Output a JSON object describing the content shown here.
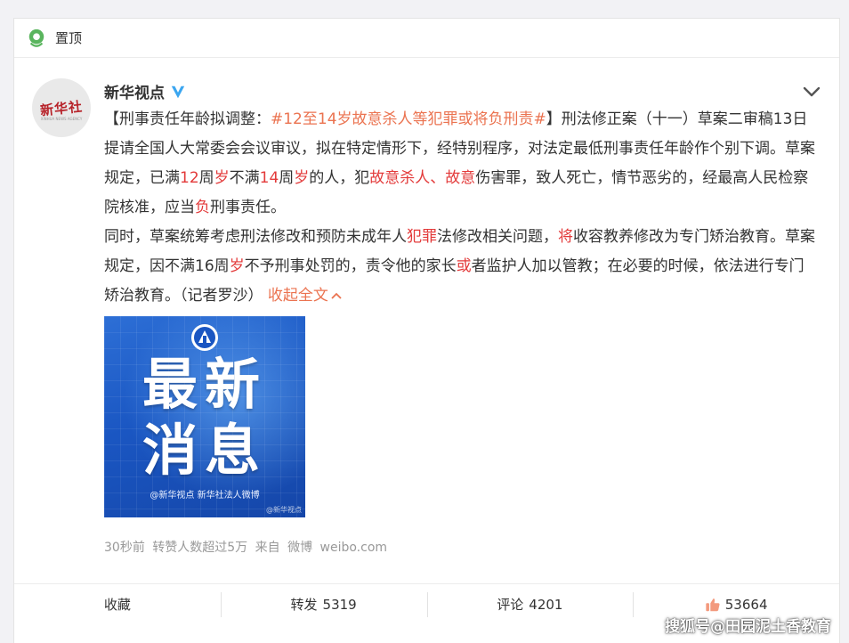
{
  "pinned": {
    "label": "置顶"
  },
  "post": {
    "avatar_text": "新华社",
    "avatar_sub": "XINHUA NEWS AGENCY",
    "username": "新华视点",
    "content": {
      "p1_open": "【刑事责任年龄拟调整：",
      "p1_tag": "#12至14岁故意杀人等犯罪或将负刑责#",
      "p1_close": "】刑法修正案（十一）草案二审稿13日提请全国人大常委会会议审议，拟在特定情形下，经特别程序，对法定最低刑事责任年龄作个别下调。草案规定，已满",
      "p1_n12": "12",
      "p1_t1": "周",
      "p1_sui1": "岁",
      "p1_t2": "不满",
      "p1_n14": "14",
      "p1_t3": "周",
      "p1_sui2": "岁",
      "p1_t4": "的人，犯",
      "p1_kill": "故意杀人",
      "p1_sep": "、",
      "p1_intent": "故意",
      "p1_t5": "伤害罪，致人死亡，情节恶劣的，经最高人民检察院核准，应当",
      "p1_fu": "负",
      "p1_t6": "刑事责任。",
      "p2_t1": "同时，草案统筹考虑刑法修改和预防未成年人",
      "p2_crime": "犯罪",
      "p2_t2": "法修改相关问题，",
      "p2_jiang": "将",
      "p2_t3": "收容教养修改为专门矫治教育。草案规定，因不满16周",
      "p2_sui": "岁",
      "p2_t4": "不予刑事处罚的，责令他的家长",
      "p2_huo": "或",
      "p2_t5": "者监护人加以管教；在必要的时候，依法进行专门矫治教育。（记者罗沙）",
      "collapse": "收起全文"
    },
    "image": {
      "title_line1": "最新",
      "title_line2": "消息",
      "credit": "@新华视点  新华社法人微博",
      "watermark": "@新华视点"
    },
    "meta": "30秒前 转赞人数超过5万 来自 微博 weibo.com"
  },
  "actions": {
    "favorite": "收藏",
    "repost_label": "转发",
    "repost_count": "5319",
    "comment_label": "评论",
    "comment_count": "4201",
    "like_count": "53664"
  },
  "watermark": "搜狐号@田园泥土香教育",
  "colors": {
    "accent": "#eb7350",
    "highlight": "#e33a3a",
    "pin_green": "#5ab55e",
    "verified": "#3ba6f0"
  }
}
